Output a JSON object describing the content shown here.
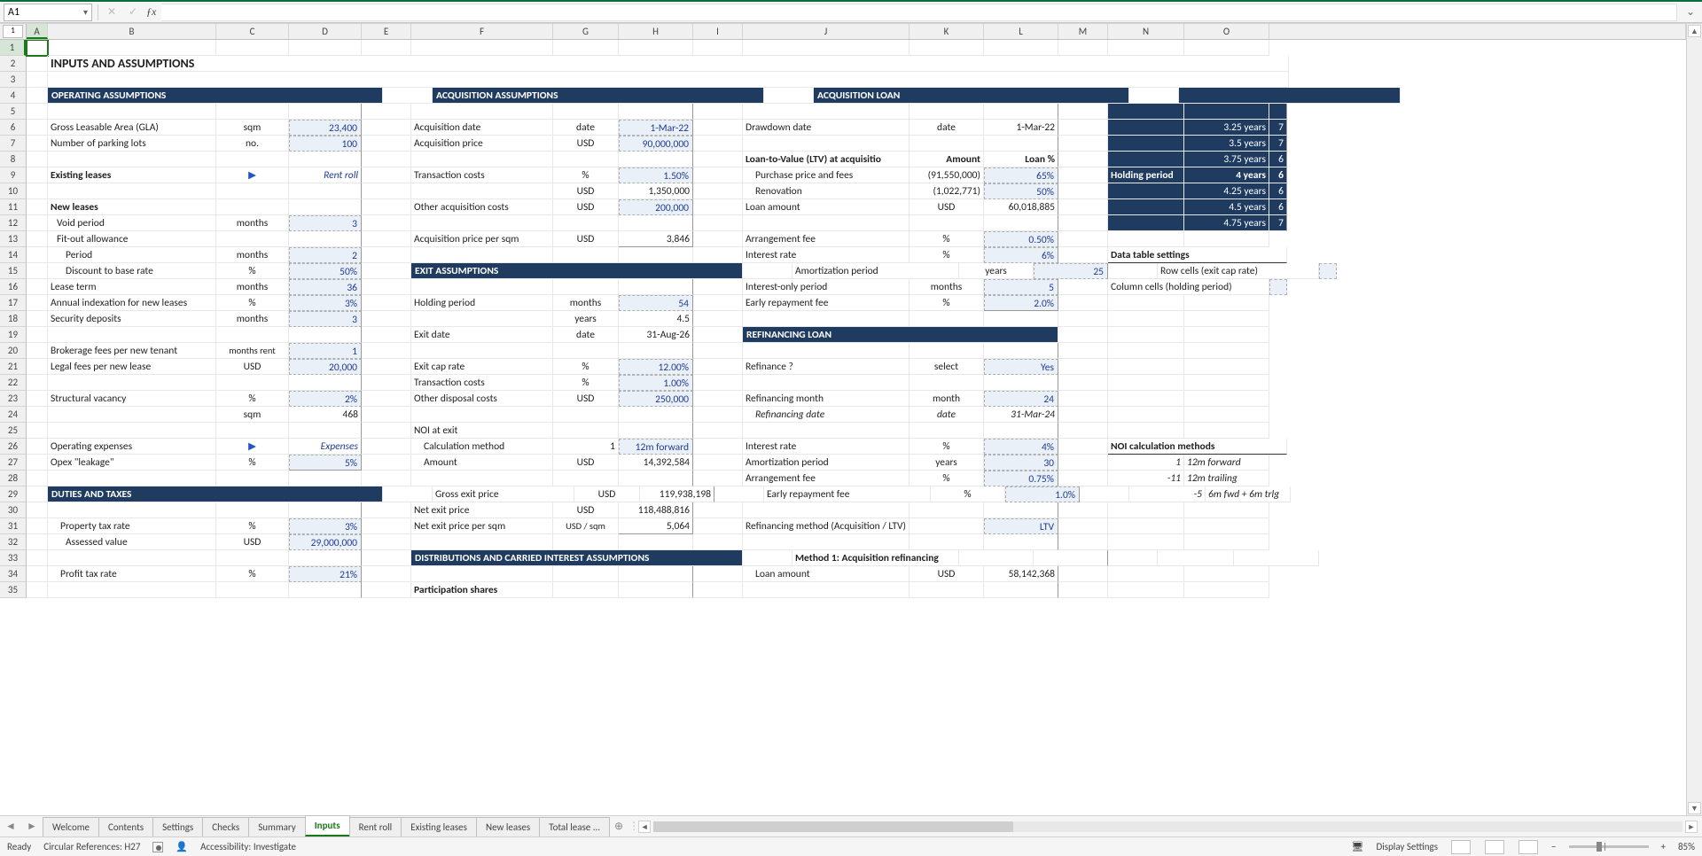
{
  "namebox": "A1",
  "outline_levels": [
    "1",
    "2"
  ],
  "columns": [
    "A",
    "B",
    "C",
    "D",
    "E",
    "F",
    "G",
    "H",
    "I",
    "J",
    "K",
    "L",
    "M",
    "N",
    "O"
  ],
  "row_count": 35,
  "title": "INPUTS AND ASSUMPTIONS",
  "sec": {
    "op": "OPERATING ASSUMPTIONS",
    "acq": "ACQUISITION ASSUMPTIONS",
    "loan": "ACQUISITION LOAN",
    "exit": "EXIT ASSUMPTIONS",
    "refi": "REFINANCING LOAN",
    "duties": "DUTIES AND TAXES",
    "dist": "DISTRIBUTIONS AND CARRIED INTEREST ASSUMPTIONS"
  },
  "op": {
    "gla_l": "Gross Leasable Area (GLA)",
    "gla_u": "sqm",
    "gla_v": "23,400",
    "park_l": "Number of parking lots",
    "park_u": "no.",
    "park_v": "100",
    "exist_l": "Existing leases",
    "exist_arrow": "▶",
    "exist_link": "Rent roll",
    "newl_l": "New leases",
    "void_l": "Void period",
    "void_u": "months",
    "void_v": "3",
    "fit_l": "Fit-out allowance",
    "period_l": "Period",
    "period_u": "months",
    "period_v": "2",
    "disc_l": "Discount to base rate",
    "disc_u": "%",
    "disc_v": "50%",
    "lease_l": "Lease term",
    "lease_u": "months",
    "lease_v": "36",
    "idx_l": "Annual indexation for new leases",
    "idx_u": "%",
    "idx_v": "3%",
    "secdep_l": "Security deposits",
    "secdep_u": "months",
    "secdep_v": "3",
    "brok_l": "Brokerage fees per new tenant",
    "brok_u": "months rent",
    "brok_v": "1",
    "legal_l": "Legal fees per new lease",
    "legal_u": "USD",
    "legal_v": "20,000",
    "sv_l": "Structural vacancy",
    "sv_u": "%",
    "sv_v": "2%",
    "sv_u2": "sqm",
    "sv_v2": "468",
    "opex_l": "Operating expenses",
    "opex_arrow": "▶",
    "opex_link": "Expenses",
    "leak_l": "Opex \"leakage\"",
    "leak_u": "%",
    "leak_v": "5%"
  },
  "acq": {
    "date_l": "Acquisition date",
    "date_u": "date",
    "date_v": "1-Mar-22",
    "price_l": "Acquisition price",
    "price_u": "USD",
    "price_v": "90,000,000",
    "tc_l": "Transaction costs",
    "tc_u": "%",
    "tc_v": "1.50%",
    "tc_u2": "USD",
    "tc_v2": "1,350,000",
    "other_l": "Other acquisition costs",
    "other_u": "USD",
    "other_v": "200,000",
    "psqm_l": "Acquisition price per sqm",
    "psqm_u": "USD",
    "psqm_v": "3,846"
  },
  "exit": {
    "hp_l": "Holding period",
    "hp_u": "months",
    "hp_v": "54",
    "hp_u2": "years",
    "hp_v2": "4.5",
    "ed_l": "Exit date",
    "ed_u": "date",
    "ed_v": "31-Aug-26",
    "cap_l": "Exit cap rate",
    "cap_u": "%",
    "cap_v": "12.00%",
    "tc_l": "Transaction costs",
    "tc_u": "%",
    "tc_v": "1.00%",
    "other_l": "Other disposal costs",
    "other_u": "USD",
    "other_v": "250,000",
    "noi_l": "NOI at exit",
    "calc_l": "Calculation method",
    "calc_idx": "1",
    "calc_v": "12m forward",
    "amt_l": "Amount",
    "amt_u": "USD",
    "amt_v": "14,392,584",
    "gep_l": "Gross exit price",
    "gep_u": "USD",
    "gep_v": "119,938,198",
    "nep_l": "Net exit price",
    "nep_u": "USD",
    "nep_v": "118,488,816",
    "nepsq_l": "Net exit price per sqm",
    "nepsq_u": "USD / sqm",
    "nepsq_v": "5,064"
  },
  "dist": {
    "part_l": "Participation shares"
  },
  "loan": {
    "dd_l": "Drawdown date",
    "dd_u": "date",
    "dd_v": "1-Mar-22",
    "ltv_l": "Loan-to-Value (LTV) at acquisitio",
    "amt_h": "Amount",
    "loan_h": "Loan %",
    "pp_l": "Purchase price and fees",
    "pp_amt": "(91,550,000)",
    "pp_pct": "65%",
    "ren_l": "Renovation",
    "ren_amt": "(1,022,771)",
    "ren_pct": "50%",
    "la_l": "Loan amount",
    "la_u": "USD",
    "la_v": "60,018,885",
    "af_l": "Arrangement fee",
    "af_u": "%",
    "af_v": "0.50%",
    "ir_l": "Interest rate",
    "ir_u": "%",
    "ir_v": "6%",
    "ap_l": "Amortization period",
    "ap_u": "years",
    "ap_v": "25",
    "io_l": "Interest-only period",
    "io_u": "months",
    "io_v": "5",
    "er_l": "Early repayment fee",
    "er_u": "%",
    "er_v": "2.0%"
  },
  "refi": {
    "q_l": "Refinance ?",
    "q_u": "select",
    "q_v": "Yes",
    "mo_l": "Refinancing month",
    "mo_u": "month",
    "mo_v": "24",
    "date_l": "Refinancing date",
    "date_u": "date",
    "date_v": "31-Mar-24",
    "ir_l": "Interest rate",
    "ir_u": "%",
    "ir_v": "4%",
    "ap_l": "Amortization period",
    "ap_u": "years",
    "ap_v": "30",
    "af_l": "Arrangement fee",
    "af_u": "%",
    "af_v": "0.75%",
    "er_l": "Early repayment fee",
    "er_u": "%",
    "er_v": "1.0%",
    "meth_l": "Refinancing method (Acquisition / LTV)",
    "meth_v": "LTV",
    "m1_l": "Method 1: Acquisition refinancing",
    "la_l": "Loan amount",
    "la_u": "USD",
    "la_v": "58,142,368"
  },
  "duties": {
    "prop_l": "Property tax rate",
    "prop_u": "%",
    "prop_v": "3%",
    "assess_l": "Assessed value",
    "assess_u": "USD",
    "assess_v": "29,000,000",
    "profit_l": "Profit tax rate",
    "profit_u": "%",
    "profit_v": "21%"
  },
  "datatable": {
    "years": [
      "3.25 years",
      "3.5 years",
      "3.75 years",
      "4 years",
      "4.25 years",
      "4.5 years",
      "4.75 years"
    ],
    "vals": [
      "7",
      "7",
      "6",
      "6",
      "6",
      "6",
      "7"
    ],
    "hp_l": "Holding period",
    "settings_h": "Data table settings",
    "row_l": "Row cells (exit cap rate)",
    "col_l": "Column cells (holding period)"
  },
  "noicalc": {
    "h": "NOI calculation methods",
    "r1_k": "1",
    "r1_v": "12m forward",
    "r2_k": "-11",
    "r2_v": "12m trailing",
    "r3_k": "-5",
    "r3_v": "6m fwd + 6m trlg"
  },
  "tabs": [
    "Welcome",
    "Contents",
    "Settings",
    "Checks",
    "Summary",
    "Inputs",
    "Rent roll",
    "Existing leases",
    "New leases",
    "Total lease ..."
  ],
  "active_tab": 5,
  "status": {
    "ready": "Ready",
    "circ": "Circular References: H27",
    "acc": "Accessibility: Investigate",
    "disp": "Display Settings",
    "zoom": "85%"
  }
}
